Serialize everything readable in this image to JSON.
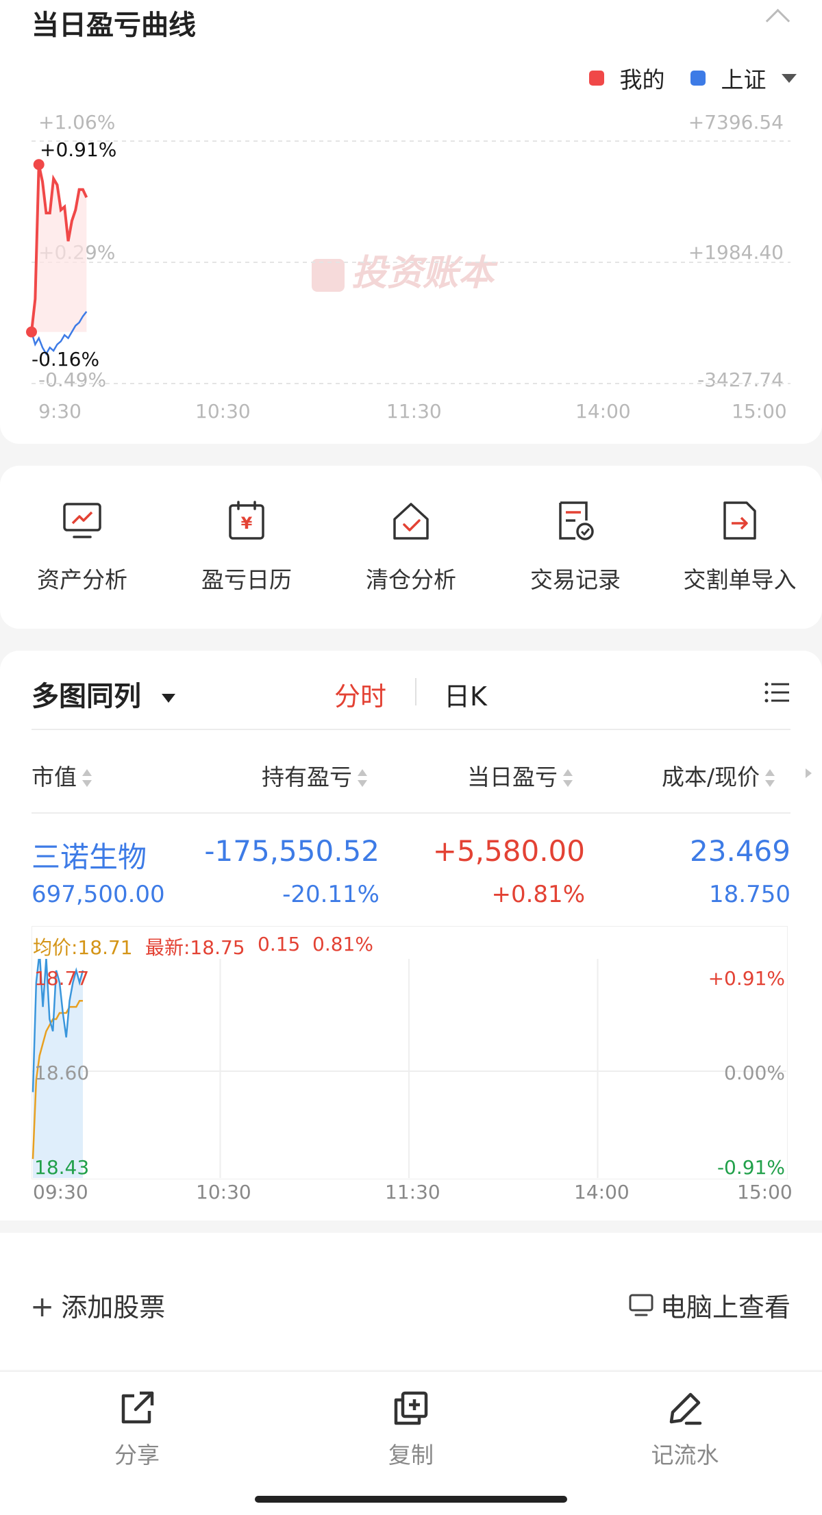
{
  "pl_curve": {
    "title": "当日盈亏曲线",
    "legend": [
      {
        "label": "我的",
        "color": "#f04848"
      },
      {
        "label": "上证",
        "color": "#3d7be6"
      }
    ],
    "left_ticks": [
      "+1.06%",
      "+0.29%",
      "-0.49%"
    ],
    "right_ticks": [
      "+7396.54",
      "+1984.40",
      "-3427.74"
    ],
    "time_ticks": [
      "9:30",
      "10:30",
      "11:30",
      "14:00",
      "15:00"
    ],
    "max_label": "+0.91%",
    "min_label": "-0.16%",
    "watermark": "投资账本",
    "chart_data": {
      "type": "line",
      "x": [
        "9:30",
        "9:31",
        "9:32",
        "9:33",
        "9:34",
        "9:35",
        "9:36",
        "9:37",
        "9:38",
        "9:39",
        "9:40",
        "9:41",
        "9:42",
        "9:43",
        "9:44",
        "9:45"
      ],
      "series": [
        {
          "name": "我的",
          "values": [
            -0.16,
            0.05,
            0.91,
            0.8,
            0.6,
            0.6,
            0.82,
            0.78,
            0.62,
            0.64,
            0.42,
            0.55,
            0.62,
            0.75,
            0.75,
            0.7
          ]
        },
        {
          "name": "上证",
          "values": [
            -0.16,
            -0.24,
            -0.2,
            -0.26,
            -0.3,
            -0.26,
            -0.28,
            -0.24,
            -0.22,
            -0.18,
            -0.2,
            -0.16,
            -0.12,
            -0.1,
            -0.06,
            -0.03
          ]
        }
      ],
      "ylim": [
        -0.49,
        1.06
      ]
    }
  },
  "tools": [
    {
      "label": "资产分析",
      "icon": "monitor-chart-icon"
    },
    {
      "label": "盈亏日历",
      "icon": "calendar-yen-icon"
    },
    {
      "label": "清仓分析",
      "icon": "house-check-icon"
    },
    {
      "label": "交易记录",
      "icon": "receipt-check-icon"
    },
    {
      "label": "交割单导入",
      "icon": "file-import-icon"
    }
  ],
  "list": {
    "view_mode": "多图同列",
    "tabs": [
      "分时",
      "日K"
    ],
    "columns": [
      "市值",
      "持有盈亏",
      "当日盈亏",
      "成本/现价"
    ],
    "stock": {
      "name": "三诺生物",
      "market_value": "697,500.00",
      "hold_pl": "-175,550.52",
      "hold_pl_pct": "-20.11%",
      "day_pl": "+5,580.00",
      "day_pl_pct": "+0.81%",
      "cost": "23.469",
      "price": "18.750"
    },
    "mini_chart": {
      "avg_label": "均价:18.71",
      "latest_label": "最新:18.75",
      "change": "0.15",
      "change_pct": "0.81%",
      "left_ticks": [
        "18.77",
        "18.60",
        "18.43"
      ],
      "right_ticks": [
        "+0.91%",
        "0.00%",
        "-0.91%"
      ],
      "time_ticks": [
        "09:30",
        "10:30",
        "11:30",
        "14:00",
        "15:00"
      ],
      "chart_data": {
        "type": "line",
        "x": [
          "09:30",
          "09:31",
          "09:32",
          "09:33",
          "09:34",
          "09:35",
          "09:36",
          "09:37",
          "09:38",
          "09:39",
          "09:40",
          "09:41",
          "09:42",
          "09:43",
          "09:44",
          "09:45"
        ],
        "series": [
          {
            "name": "最新",
            "values": [
              18.56,
              18.74,
              18.79,
              18.7,
              18.78,
              18.68,
              18.66,
              18.76,
              18.74,
              18.69,
              18.65,
              18.71,
              18.74,
              18.76,
              18.74,
              18.76
            ]
          },
          {
            "name": "均价",
            "values": [
              18.45,
              18.58,
              18.62,
              18.64,
              18.66,
              18.67,
              18.68,
              18.68,
              18.69,
              18.69,
              18.69,
              18.7,
              18.7,
              18.7,
              18.71,
              18.71
            ]
          }
        ],
        "ylim": [
          18.43,
          18.77
        ]
      }
    }
  },
  "footer": {
    "add_stock": "添加股票",
    "view_on_pc": "电脑上查看"
  },
  "bottom_nav": [
    {
      "label": "分享",
      "icon": "share-icon"
    },
    {
      "label": "复制",
      "icon": "copy-icon"
    },
    {
      "label": "记流水",
      "icon": "edit-pen-icon"
    }
  ]
}
